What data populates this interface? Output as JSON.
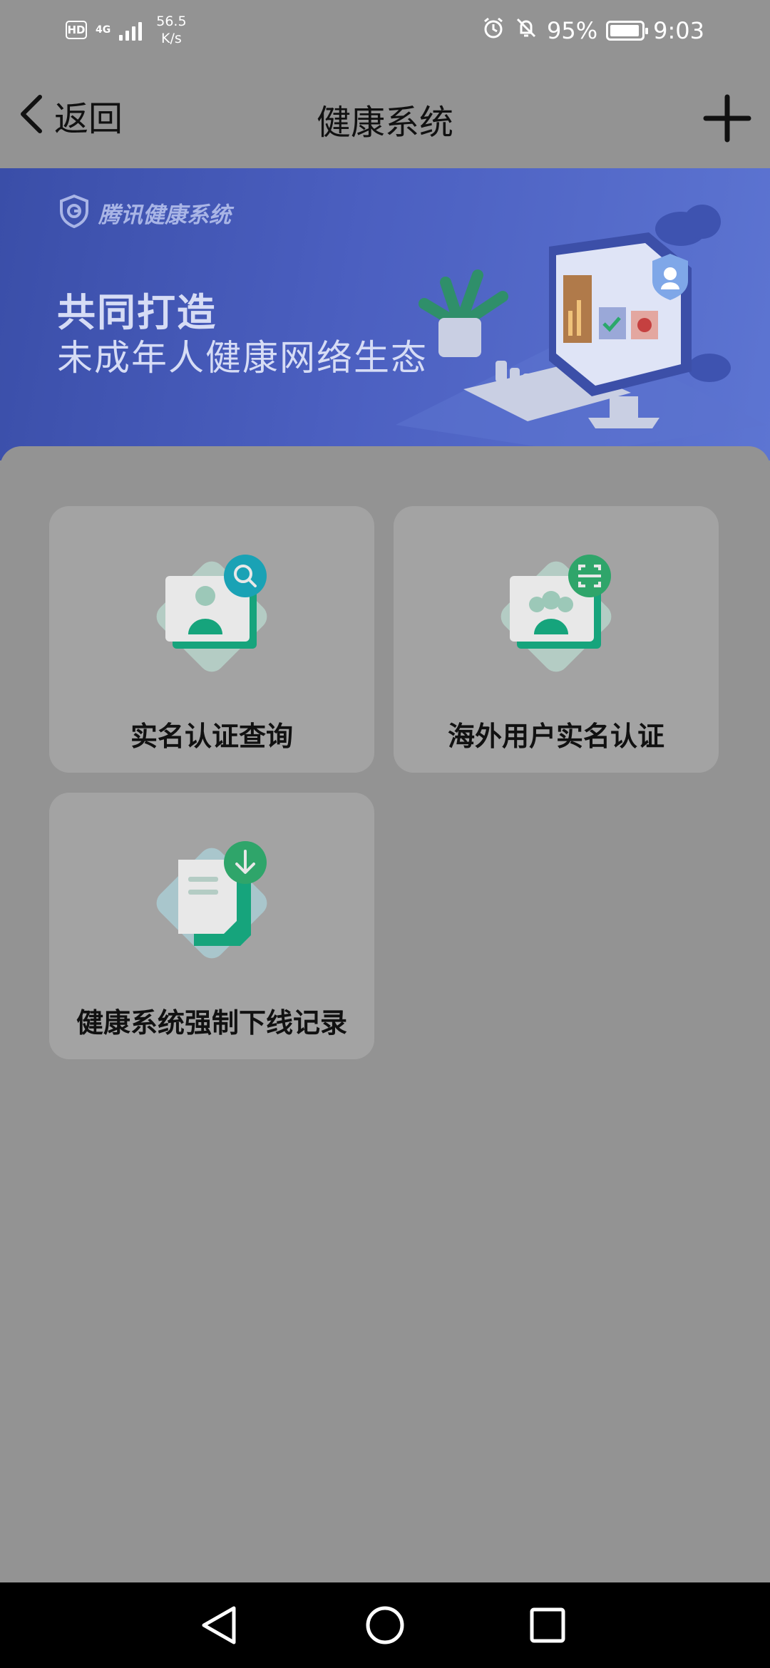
{
  "status_bar": {
    "hd": "HD",
    "network": "4G",
    "speed_value": "56.5",
    "speed_unit": "K/s",
    "battery": "95%",
    "battery_level": 0.95,
    "time": "9:03"
  },
  "header": {
    "back_label": "返回",
    "title": "健康系统",
    "add_icon": "plus-icon"
  },
  "banner": {
    "brand": "腾讯健康系统",
    "headline": "共同打造",
    "subline": "未成年人健康网络生态"
  },
  "cards": [
    {
      "label": "实名认证查询",
      "icon": "id-search-icon"
    },
    {
      "label": "海外用户实名认证",
      "icon": "overseas-id-scan-icon"
    },
    {
      "label": "健康系统强制下线记录",
      "icon": "document-download-icon"
    }
  ],
  "nav": {
    "back": "triangle-back-icon",
    "home": "circle-home-icon",
    "recents": "square-recents-icon"
  },
  "colors": {
    "overlay_bg": "#939393",
    "card_bg": "#a3a3a3",
    "banner_blue": "#4b5fc0",
    "icon_green": "#16a47c",
    "icon_teal": "#1aa2b5"
  }
}
